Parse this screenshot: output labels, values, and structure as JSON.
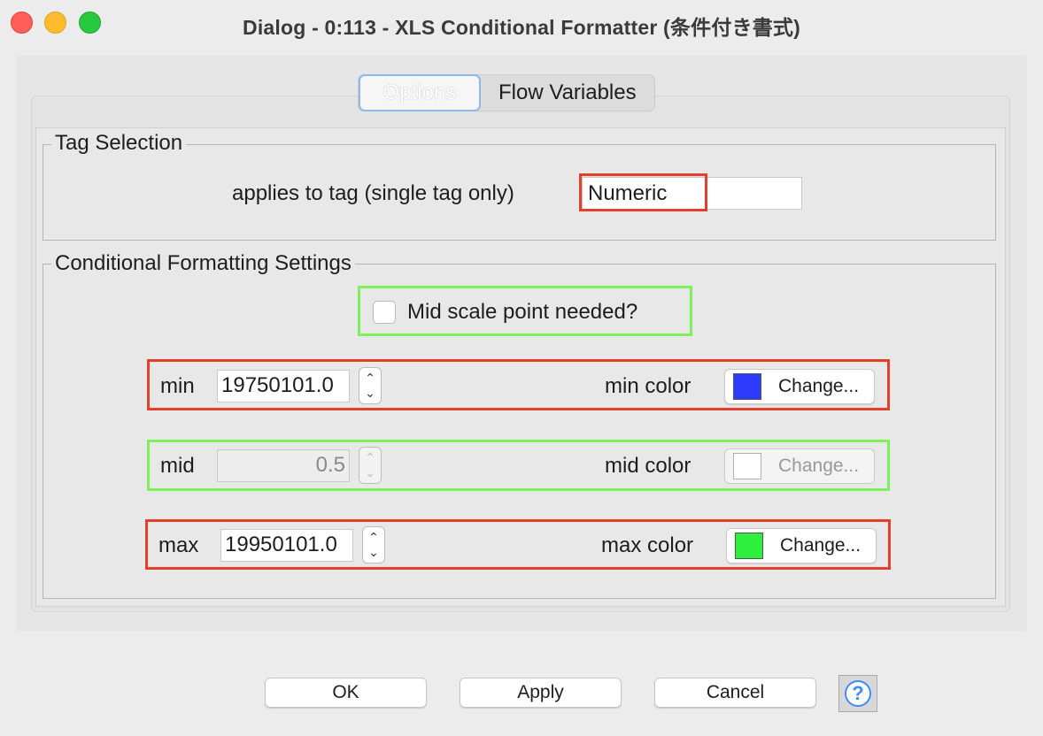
{
  "window": {
    "title": "Dialog - 0:113 - XLS Conditional Formatter (条件付き書式)"
  },
  "tabs": [
    {
      "label": "Options",
      "active": true
    },
    {
      "label": "Flow Variables",
      "active": false
    }
  ],
  "tag_selection": {
    "legend": "Tag Selection",
    "label": "applies to tag (single tag only)",
    "value": "Numeric"
  },
  "formatting": {
    "legend": "Conditional Formatting Settings",
    "mid_checkbox_label": "Mid scale point needed?",
    "mid_checkbox_checked": false,
    "min": {
      "label": "min",
      "value": "19750101.0",
      "color_label": "min color",
      "color": "#2d3bff",
      "button": "Change..."
    },
    "mid": {
      "label": "mid",
      "value": "0.5",
      "color_label": "mid color",
      "color": "#ffffff",
      "button": "Change...",
      "enabled": false
    },
    "max": {
      "label": "max",
      "value": "19950101.0",
      "color_label": "max color",
      "color": "#2df03c",
      "button": "Change..."
    }
  },
  "buttons": {
    "ok": "OK",
    "apply": "Apply",
    "cancel": "Cancel",
    "help_icon": "question-mark"
  },
  "highlight_colors": {
    "red": "#e2402b",
    "green": "#7ef05a"
  }
}
